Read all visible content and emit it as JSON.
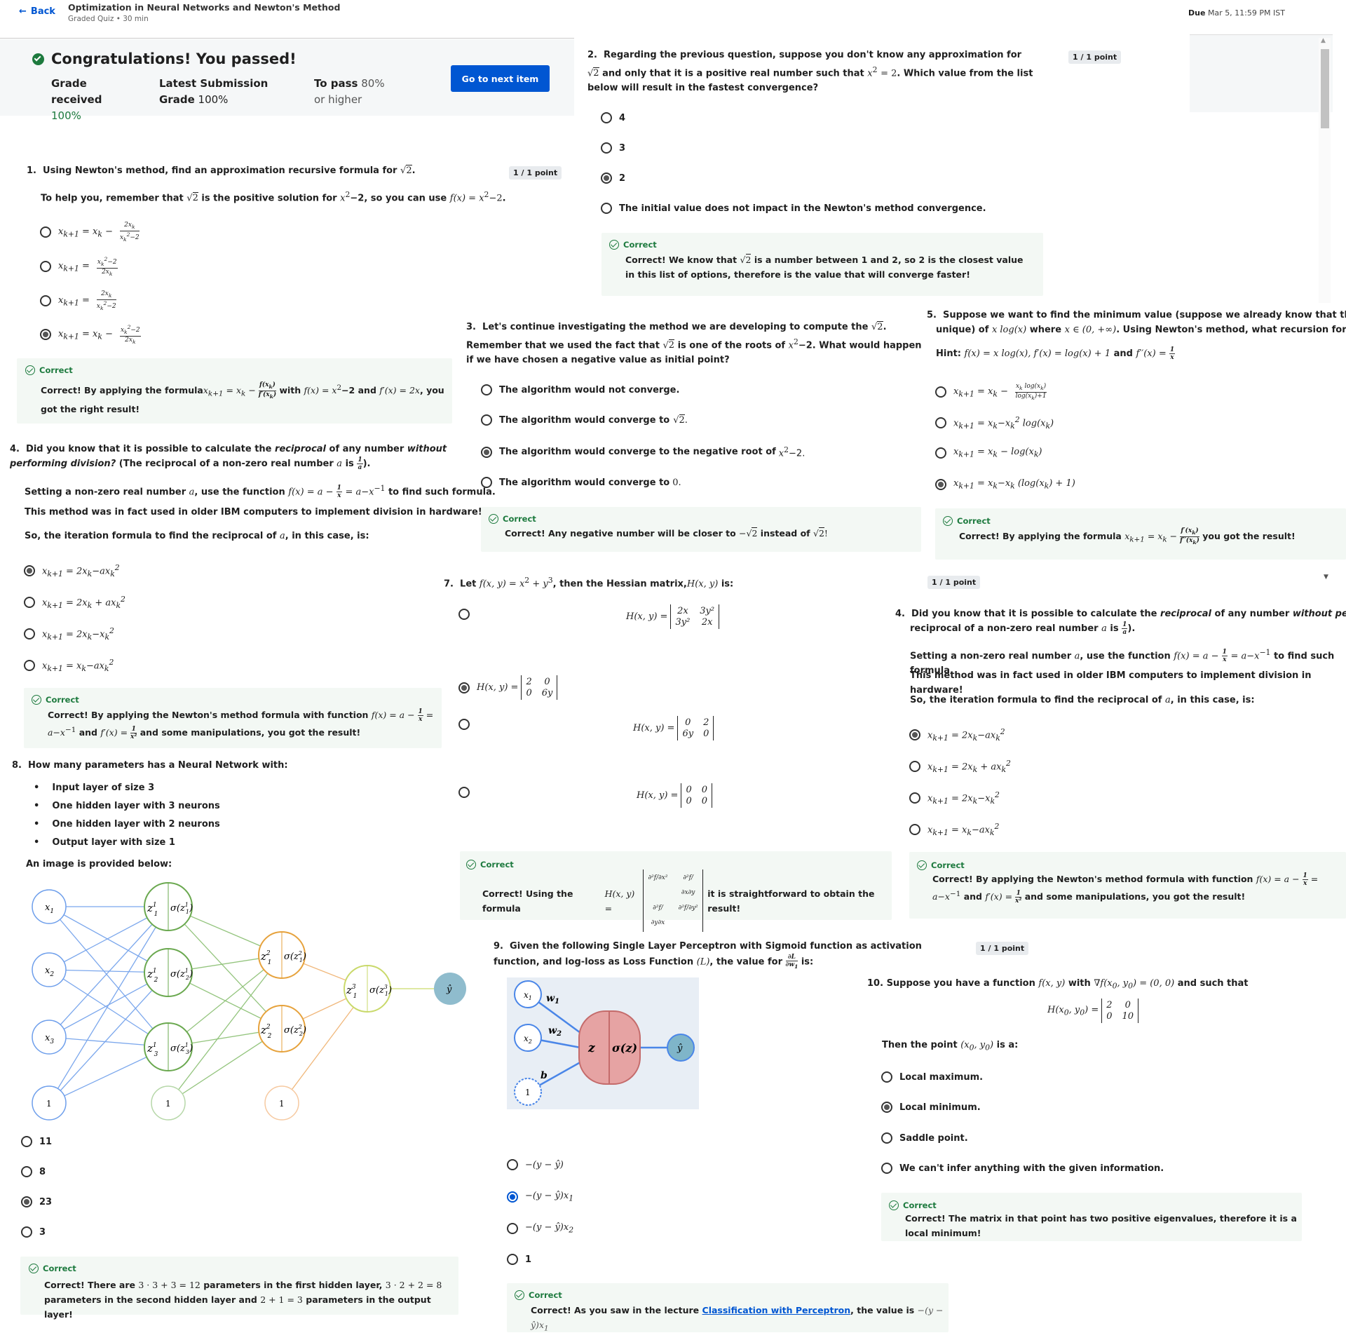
{
  "header": {
    "back": "Back",
    "title": "Optimization in Neural Networks and Newton's Method",
    "subtitle": "Graded Quiz • 30 min",
    "due_label": "Due",
    "due_value": "Mar 5, 11:59 PM IST"
  },
  "banner": {
    "title": "Congratulations! You passed!",
    "grade_label": "Grade received",
    "grade_value": "100%",
    "latest_label": "Latest Submission Grade",
    "latest_value": "100%",
    "pass_label": "To pass",
    "pass_value": "80% or higher",
    "next_button": "Go to next item"
  },
  "points": "1 / 1 point",
  "correct": "Correct",
  "q1": {
    "num": "1.",
    "text": "Using Newton's method, find an approximation recursive formula for",
    "help": "To help you, remember that",
    "help2": "is the positive solution for",
    "help3": ", so you can use",
    "feedback_a": "Correct! By applying the formula",
    "feedback_b": "with",
    "feedback_c": "and",
    "feedback_d": ", you got the right result!"
  },
  "q2": {
    "num": "2.",
    "text": "Regarding the previous question, suppose you don't know any approximation for",
    "text2": "and only that it is a positive real number such that",
    "text3": ". Which value from the list below will result in the fastest convergence?",
    "options": [
      "4",
      "3",
      "2",
      "The initial value does not impact in the Newton's method convergence."
    ],
    "feedback": "Correct! We know that",
    "feedback2": "is a number between 1 and 2, so 2 is the closest value in this list of options, therefore is the value that will converge faster!"
  },
  "q3": {
    "num": "3.",
    "text": "Let's continue investigating the method we are developing to compute the",
    "text2": ". Remember that we used the fact that",
    "text3": "is one of the roots of",
    "text4": ". What would happen if we have chosen a negative value as initial point?",
    "options": [
      "The algorithm would not converge.",
      "The algorithm would converge to",
      "The algorithm would converge to the negative root of",
      "The algorithm would converge to"
    ],
    "feedback": "Correct! Any negative number will be closer to",
    "feedback2": "instead of"
  },
  "q4": {
    "num": "4.",
    "text": "Did you know that it is possible to calculate the",
    "reciprocal": "reciprocal",
    "text2": "of any number",
    "without": "without performing division?",
    "text3": "(The reciprocal of a non-zero real number",
    "text4": "is",
    "setting": "Setting a non-zero real number",
    "setting2": ", use the function",
    "setting3": "to find such formula.",
    "ibm": "This method was in fact used in older IBM computers to implement division in hardware!",
    "iter": "So, the iteration formula to find the reciprocal of",
    "iter2": ", in this case, is:",
    "feedback": "Correct! By applying the Newton's method formula with function",
    "feedback2": "and",
    "feedback3": "and some manipulations, you got the result!"
  },
  "q5": {
    "num": "5.",
    "text": "Suppose we want to find the minimum value (suppose we already know that the minimum exists and",
    "text2": "unique) of",
    "text3": "where",
    "text4": ". Using Newton's method, what recursion formula we must",
    "hint": "Hint:",
    "feedback": "Correct! By applying the formula",
    "feedback2": "you got the result!"
  },
  "q7": {
    "num": "7.",
    "text": "Let",
    "text2": ", then the Hessian matrix,",
    "text3": "is:",
    "feedback": "Correct! Using the formula",
    "feedback2": "it is straightforward to obtain the result!"
  },
  "q8": {
    "num": "8.",
    "text": "How many parameters has a Neural Network with:",
    "bullets": [
      "Input layer of size 3",
      "One hidden layer with 3 neurons",
      "One hidden layer with 2 neurons",
      "Output layer with size 1"
    ],
    "image_note": "An image is provided below:",
    "options": [
      "11",
      "8",
      "23",
      "3"
    ],
    "feedback": "Correct! There are",
    "feedback2": "parameters in the first hidden layer,",
    "feedback3": "parameters in the second hidden layer and",
    "feedback4": "parameters in the output layer!"
  },
  "q9": {
    "num": "9.",
    "text": "Given the following Single Layer Perceptron with Sigmoid function as activation function, and log-loss as Loss Function",
    "text2": ", the value for",
    "text3": "is:",
    "feedback": "Correct! As you saw in the lecture",
    "link": "Classification with Perceptron",
    "feedback2": ", the value is"
  },
  "q10": {
    "num": "10.",
    "text": "Suppose you have a function",
    "text2": "with",
    "text3": "and such that",
    "then": "Then the point",
    "then2": "is a:",
    "options": [
      "Local maximum.",
      "Local minimum.",
      "Saddle point.",
      "We can't infer anything with the given information."
    ],
    "feedback": "Correct! The matrix in that point has two positive eigenvalues, therefore it is a local minimum!"
  },
  "colors": {
    "accent": "#0056d2",
    "success": "#1d7a3e",
    "green_node": "#6aa84f",
    "orange_node": "#e6a23c",
    "yellow_node": "#c9d96a",
    "blue_node": "#4a86e8",
    "output": "#8fbccd"
  }
}
